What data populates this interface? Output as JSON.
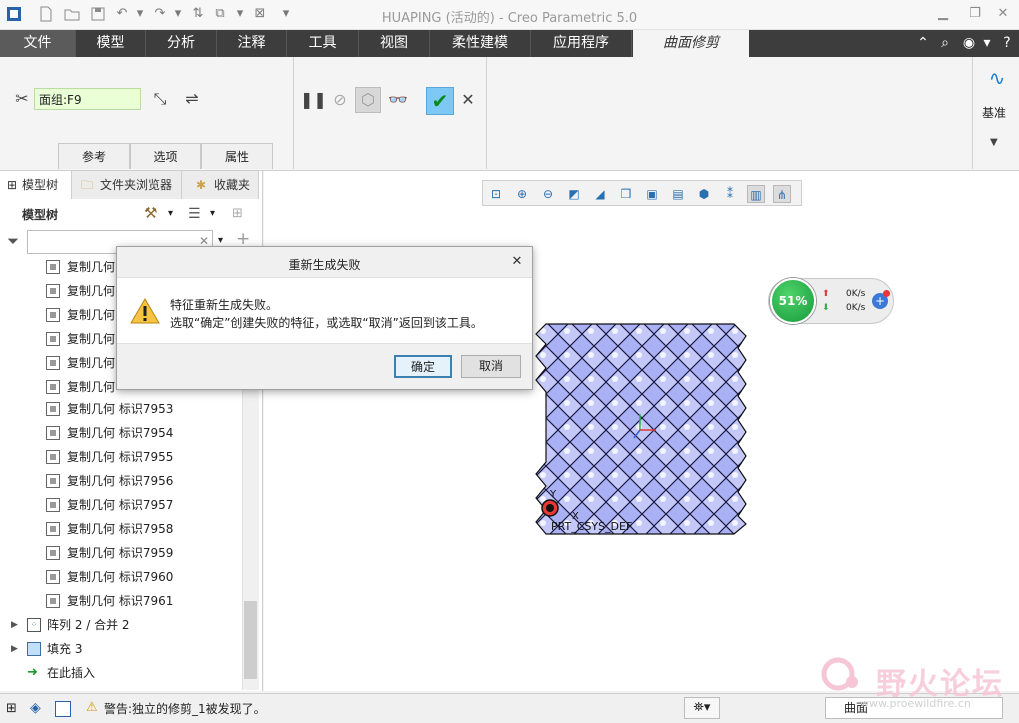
{
  "app": {
    "title": "HUAPING (活动的) - Creo Parametric 5.0"
  },
  "menu": {
    "tabs": [
      "文件",
      "模型",
      "分析",
      "注释",
      "工具",
      "视图",
      "柔性建模",
      "应用程序",
      "曲面修剪"
    ],
    "active_tab": "曲面修剪"
  },
  "ribbon": {
    "surface_field_value": "面组:F9",
    "subtabs": [
      "参考",
      "选项",
      "属性"
    ],
    "datum_label": "基准",
    "colors": {
      "ok_button_bg": "#7ec8f5",
      "field_bg": "#eaffd6"
    }
  },
  "left_panel": {
    "tabs": [
      "模型树",
      "文件夹浏览器",
      "收藏夹"
    ],
    "tree_title": "模型树",
    "tree_items": [
      "复制几何",
      "复制几何",
      "复制几何",
      "复制几何",
      "复制几何",
      "复制几何",
      "复制几何 标识7953",
      "复制几何 标识7954",
      "复制几何 标识7955",
      "复制几何 标识7956",
      "复制几何 标识7957",
      "复制几何 标识7958",
      "复制几何 标识7959",
      "复制几何 标识7960",
      "复制几何 标识7961"
    ],
    "group_items": [
      "阵列 2 / 合并 2",
      "填充 3"
    ],
    "insert_here": "在此插入"
  },
  "dialog": {
    "title": "重新生成失败",
    "line1": "特征重新生成失败。",
    "line2": "选取“确定”创建失败的特征，或选取“取消”返回到该工具。",
    "confirm_label": "确定",
    "cancel_label": "取消"
  },
  "viewport": {
    "csys_label": "PRT_CSYS_DEF",
    "axis_y": "Y",
    "axis_x": "X",
    "surface_color": "#aab0f4"
  },
  "network": {
    "percent": "51%",
    "upload": "0K/s",
    "download": "0K/s"
  },
  "status": {
    "message": "警告:独立的修剪_1被发现了。",
    "filter_value": "曲面"
  },
  "watermark": {
    "text": "野火论坛",
    "url": "www.proewildfire.cn"
  }
}
